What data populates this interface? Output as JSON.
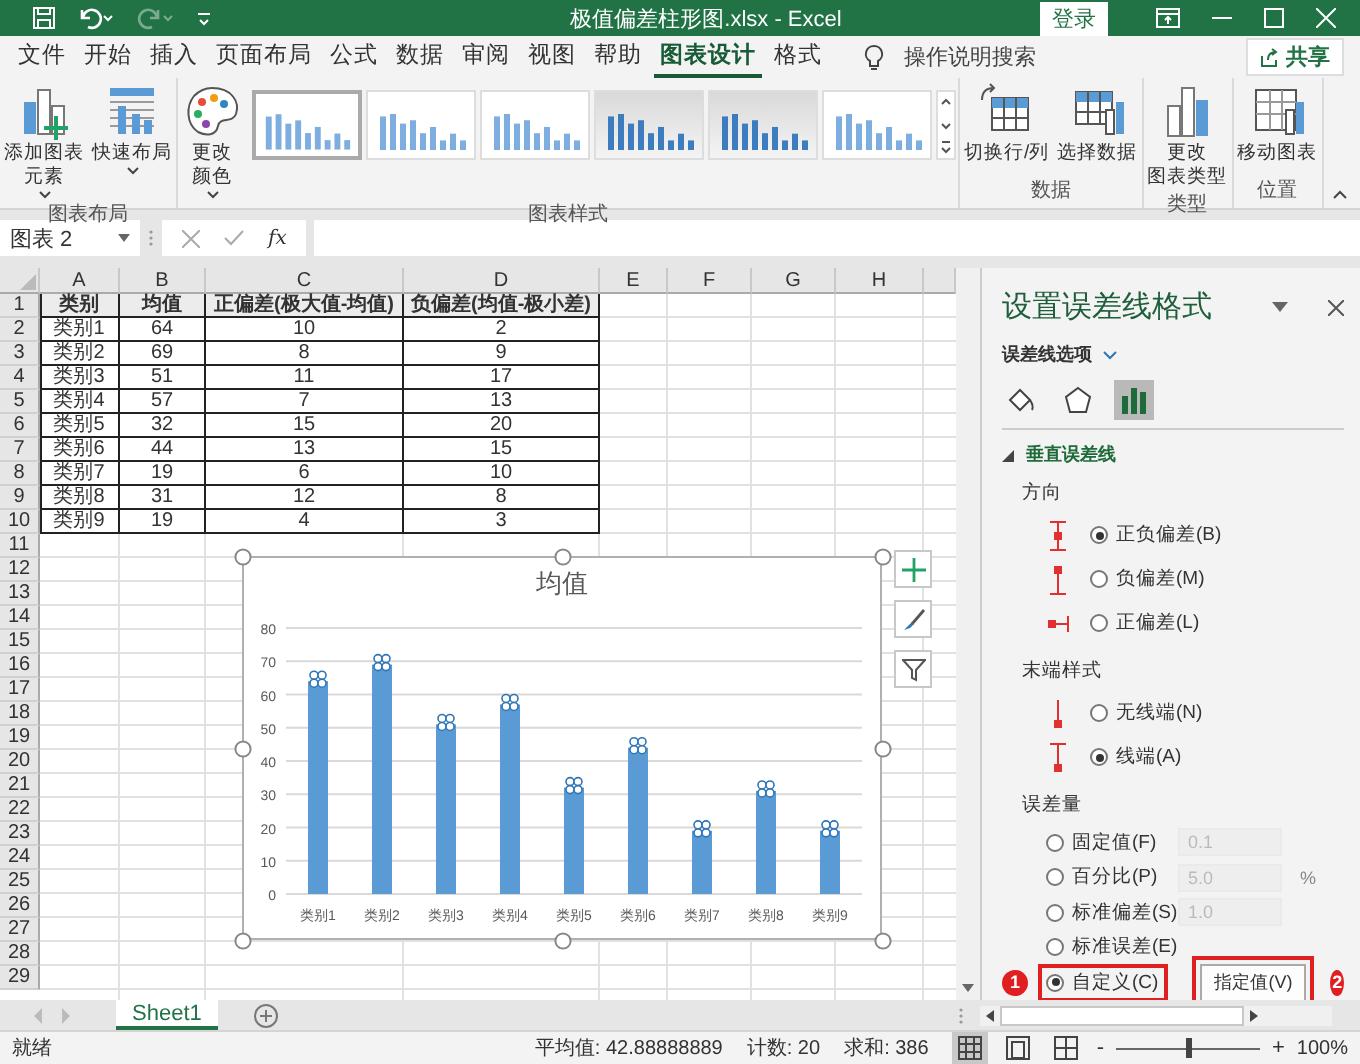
{
  "title_bar": {
    "quick_access": [
      {
        "kind": "save",
        "disabled": false
      },
      {
        "kind": "undo",
        "disabled": false
      },
      {
        "kind": "redo",
        "disabled": true
      },
      {
        "kind": "customize",
        "disabled": false
      }
    ],
    "title": "极值偏差柱形图.xlsx - Excel",
    "sign_in": "登录"
  },
  "tabs": [
    {
      "label": "文件",
      "selected": false
    },
    {
      "label": "开始",
      "selected": false
    },
    {
      "label": "插入",
      "selected": false
    },
    {
      "label": "页面布局",
      "selected": false
    },
    {
      "label": "公式",
      "selected": false
    },
    {
      "label": "数据",
      "selected": false
    },
    {
      "label": "审阅",
      "selected": false
    },
    {
      "label": "视图",
      "selected": false
    },
    {
      "label": "帮助",
      "selected": false
    },
    {
      "label": "图表设计",
      "selected": true
    },
    {
      "label": "格式",
      "selected": false
    }
  ],
  "search": {
    "placeholder": "操作说明搜索"
  },
  "share": "共享",
  "ribbon": {
    "groups": [
      {
        "label": "图表布局",
        "buttons": [
          {
            "kind": "add-element",
            "lines": [
              "添加图表",
              "元素"
            ],
            "dropdown": true
          },
          {
            "kind": "quick-layout",
            "lines": [
              "快速布局"
            ],
            "dropdown": true
          }
        ]
      },
      {
        "label": "图表样式",
        "buttons": [
          {
            "kind": "colors",
            "lines": [
              "更改",
              "颜色"
            ],
            "dropdown": true
          }
        ],
        "styles": [
          {
            "selected": true,
            "shaded": false
          },
          {
            "selected": false,
            "shaded": false
          },
          {
            "selected": false,
            "shaded": false
          },
          {
            "selected": false,
            "shaded": true
          },
          {
            "selected": false,
            "shaded": true
          },
          {
            "selected": false,
            "shaded": false
          }
        ]
      },
      {
        "label": "数据",
        "buttons": [
          {
            "kind": "switch",
            "lines": [
              "切换行/列"
            ],
            "dropdown": false
          },
          {
            "kind": "select-data",
            "lines": [
              "选择数据"
            ],
            "dropdown": false
          }
        ]
      },
      {
        "label": "类型",
        "buttons": [
          {
            "kind": "chart-type",
            "lines": [
              "更改",
              "图表类型"
            ],
            "dropdown": false
          }
        ]
      },
      {
        "label": "位置",
        "buttons": [
          {
            "kind": "move",
            "lines": [
              "移动图表"
            ],
            "dropdown": false
          }
        ]
      }
    ]
  },
  "formula_bar": {
    "name_box": "图表 2",
    "fx": "fx"
  },
  "sheet": {
    "columns": [
      "A",
      "B",
      "C",
      "D",
      "E",
      "F",
      "G",
      "H"
    ],
    "row_numbers": [
      "1",
      "2",
      "3",
      "4",
      "5",
      "6",
      "7",
      "8",
      "9",
      "10",
      "11",
      "12",
      "13",
      "14",
      "15",
      "16",
      "17",
      "18",
      "19",
      "20",
      "21",
      "22",
      "23",
      "24",
      "25",
      "26",
      "27",
      "28",
      "29"
    ],
    "cells": [
      [
        "类别",
        "均值",
        "正偏差(极大值-均值)",
        "负偏差(均值-极小差)"
      ],
      [
        "类别1",
        "64",
        "10",
        "2"
      ],
      [
        "类别2",
        "69",
        "8",
        "9"
      ],
      [
        "类别3",
        "51",
        "11",
        "17"
      ],
      [
        "类别4",
        "57",
        "7",
        "13"
      ],
      [
        "类别5",
        "32",
        "15",
        "20"
      ],
      [
        "类别6",
        "44",
        "13",
        "15"
      ],
      [
        "类别7",
        "19",
        "6",
        "10"
      ],
      [
        "类别8",
        "31",
        "12",
        "8"
      ],
      [
        "类别9",
        "19",
        "4",
        "3"
      ]
    ],
    "chart": {
      "chart_data": {
        "type": "bar",
        "title": "均值",
        "categories": [
          "类别1",
          "类别2",
          "类别3",
          "类别4",
          "类别5",
          "类别6",
          "类别7",
          "类别8",
          "类别9"
        ],
        "series": [
          {
            "color": "#5b9bd5",
            "values": [
              64,
              69,
              51,
              57,
              32,
              44,
              19,
              31,
              19
            ]
          }
        ],
        "grid": true,
        "ylim": [
          0,
          80
        ],
        "yticks": [
          0,
          10,
          20,
          30,
          40,
          50,
          60,
          70,
          80
        ]
      },
      "side_buttons": [
        {
          "kind": "elements"
        },
        {
          "kind": "styles"
        },
        {
          "kind": "filters"
        }
      ]
    }
  },
  "sheet_tabs": [
    {
      "label": "Sheet1",
      "selected": true
    }
  ],
  "status_bar": {
    "mode": "就绪",
    "stats": [
      "平均值: 42.88888889",
      "计数: 20",
      "求和: 386"
    ],
    "views": [
      {
        "kind": "normal",
        "selected": true
      },
      {
        "kind": "page-layout",
        "selected": false
      },
      {
        "kind": "page-break",
        "selected": false
      }
    ],
    "zoom_out": "-",
    "zoom_in": "+",
    "zoom": {
      "level": 0.5
    },
    "zoom_label": "100%"
  },
  "pane": {
    "title": "设置误差线格式",
    "options_label": "误差线选项",
    "icon_tabs": [
      {
        "kind": "fill",
        "selected": false
      },
      {
        "kind": "effects",
        "selected": false
      },
      {
        "kind": "options",
        "selected": true
      }
    ],
    "section": {
      "label": "垂直误差线",
      "expanded": true
    },
    "direction": {
      "label": "方向",
      "options": [
        {
          "kind": "both",
          "label": "正负偏差(B)",
          "selected": true
        },
        {
          "kind": "minus",
          "label": "负偏差(M)",
          "selected": false
        },
        {
          "kind": "plus",
          "label": "正偏差(L)",
          "selected": false
        }
      ]
    },
    "end_style": {
      "label": "末端样式",
      "options": [
        {
          "kind": "no-cap",
          "label": "无线端(N)",
          "selected": false
        },
        {
          "kind": "cap",
          "label": "线端(A)",
          "selected": true
        }
      ]
    },
    "amount": {
      "label": "误差量",
      "options": [
        {
          "label": "固定值(F)",
          "selected": false,
          "field": {
            "value": "0.1",
            "disabled": true
          }
        },
        {
          "label": "百分比(P)",
          "selected": false,
          "field": {
            "value": "5.0",
            "disabled": true
          },
          "unit": "%"
        },
        {
          "label": "标准偏差(S)",
          "selected": false,
          "field": {
            "value": "1.0",
            "disabled": true
          }
        },
        {
          "label": "标准误差(E)",
          "selected": false
        },
        {
          "label": "自定义(C)",
          "selected": true,
          "highlighted": true,
          "callout": "1"
        }
      ]
    },
    "specify_button": {
      "label": "指定值(V)",
      "highlighted": true,
      "callout": "2"
    }
  }
}
